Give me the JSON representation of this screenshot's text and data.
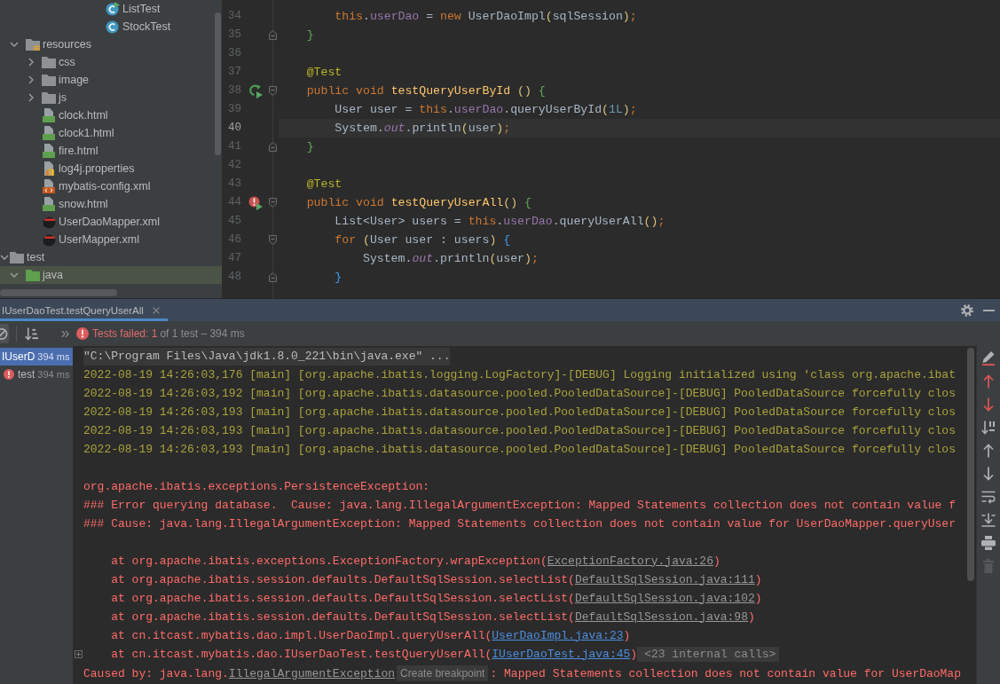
{
  "project_tree": {
    "items": [
      {
        "children": [
          {
            "children": [
              {
                "children": [
                  {
                    "children": [
                      {
                        "children": [
                          {
                            "children": [
                              {
                                "label": "ListTest",
                                "kind": "testclass",
                                "selected": false
                              },
                              {
                                "label": "StockTest",
                                "kind": "class",
                                "selected": false
                              }
                            ]
                          }
                        ]
                      }
                    ]
                  }
                ]
              }
            ]
          },
          {
            "label": "resources",
            "kind": "resfolder",
            "expanded": true,
            "selected": false,
            "children": [
              {
                "label": "css",
                "kind": "folder",
                "expanded": false,
                "selected": false
              },
              {
                "label": "image",
                "kind": "folder",
                "expanded": false,
                "selected": false
              },
              {
                "label": "js",
                "kind": "folder",
                "expanded": false,
                "selected": false
              },
              {
                "label": "clock.html",
                "kind": "html",
                "selected": false
              },
              {
                "label": "clock1.html",
                "kind": "html",
                "selected": false
              },
              {
                "label": "fire.html",
                "kind": "html",
                "selected": false
              },
              {
                "label": "log4j.properties",
                "kind": "props",
                "selected": false
              },
              {
                "label": "mybatis-config.xml",
                "kind": "xml",
                "selected": false
              },
              {
                "label": "snow.html",
                "kind": "html",
                "selected": false
              },
              {
                "label": "UserDaoMapper.xml",
                "kind": "mapper",
                "selected": false
              },
              {
                "label": "UserMapper.xml",
                "kind": "mapper",
                "selected": false
              }
            ]
          }
        ]
      },
      {
        "label": "test",
        "kind": "folder",
        "expanded": true,
        "selected": false,
        "children": [
          {
            "label": "java",
            "kind": "testroot",
            "expanded": true,
            "selected": true
          }
        ]
      }
    ]
  },
  "editor": {
    "lines": [
      {
        "number": "34",
        "current": false,
        "fold_start": false,
        "fold_end": false,
        "test_passed": false,
        "test_failed": false,
        "tokens": [
          {
            "text": "        this",
            "kind": "kw"
          },
          {
            "text": ".",
            "kind": "plain"
          },
          {
            "text": "userDao",
            "kind": "field"
          },
          {
            "text": " = ",
            "kind": "plain"
          },
          {
            "text": "new",
            "kind": "kw"
          },
          {
            "text": " UserDaoImpl",
            "kind": "plain"
          },
          {
            "text": "(",
            "kind": "b1"
          },
          {
            "text": "sqlSession",
            "kind": "plain"
          },
          {
            "text": ")",
            "kind": "b1"
          },
          {
            "text": ";",
            "kind": "kw"
          }
        ]
      },
      {
        "number": "35",
        "current": false,
        "fold_start": false,
        "fold_end": true,
        "test_passed": false,
        "test_failed": false,
        "tokens": [
          {
            "text": "    }",
            "kind": "b2"
          }
        ]
      },
      {
        "number": "36",
        "current": false,
        "fold_start": false,
        "fold_end": false,
        "test_passed": false,
        "test_failed": false
      },
      {
        "number": "37",
        "current": false,
        "fold_start": false,
        "fold_end": false,
        "test_passed": false,
        "test_failed": false,
        "tokens": [
          {
            "text": "    @Test",
            "kind": "annot"
          }
        ]
      },
      {
        "number": "38",
        "current": false,
        "fold_start": true,
        "fold_end": false,
        "test_passed": true,
        "test_failed": false,
        "tokens": [
          {
            "text": "    public void ",
            "kind": "kw"
          },
          {
            "text": "testQueryUserById ",
            "kind": "method"
          },
          {
            "text": "() ",
            "kind": "b1"
          },
          {
            "text": "{",
            "kind": "b2"
          }
        ]
      },
      {
        "number": "39",
        "current": false,
        "fold_start": false,
        "fold_end": false,
        "test_passed": false,
        "test_failed": false,
        "tokens": [
          {
            "text": "        User user = ",
            "kind": "plain"
          },
          {
            "text": "this",
            "kind": "kw"
          },
          {
            "text": ".",
            "kind": "plain"
          },
          {
            "text": "userDao",
            "kind": "field"
          },
          {
            "text": ".queryUserById",
            "kind": "plain"
          },
          {
            "text": "(",
            "kind": "b1"
          },
          {
            "text": "1L",
            "kind": "num"
          },
          {
            "text": ")",
            "kind": "b1"
          },
          {
            "text": ";",
            "kind": "kw"
          }
        ]
      },
      {
        "number": "40",
        "current": true,
        "fold_start": false,
        "fold_end": false,
        "test_passed": false,
        "test_failed": false,
        "tokens": [
          {
            "text": "        System.",
            "kind": "plain"
          },
          {
            "text": "out",
            "kind": "static"
          },
          {
            "text": ".println",
            "kind": "plain"
          },
          {
            "text": "(",
            "kind": "b1"
          },
          {
            "text": "user",
            "kind": "plain"
          },
          {
            "text": ")",
            "kind": "b1"
          },
          {
            "text": ";",
            "kind": "kw"
          }
        ]
      },
      {
        "number": "41",
        "current": false,
        "fold_start": false,
        "fold_end": true,
        "test_passed": false,
        "test_failed": false,
        "tokens": [
          {
            "text": "    }",
            "kind": "b2"
          }
        ]
      },
      {
        "number": "42",
        "current": false,
        "fold_start": false,
        "fold_end": false,
        "test_passed": false,
        "test_failed": false
      },
      {
        "number": "43",
        "current": false,
        "fold_start": false,
        "fold_end": false,
        "test_passed": false,
        "test_failed": false,
        "tokens": [
          {
            "text": "    @Test",
            "kind": "annot"
          }
        ]
      },
      {
        "number": "44",
        "current": false,
        "fold_start": true,
        "fold_end": false,
        "test_passed": false,
        "test_failed": true,
        "tokens": [
          {
            "text": "    public void ",
            "kind": "kw"
          },
          {
            "text": "testQueryUserAll",
            "kind": "method"
          },
          {
            "text": "() ",
            "kind": "b1"
          },
          {
            "text": "{",
            "kind": "b2"
          }
        ]
      },
      {
        "number": "45",
        "current": false,
        "fold_start": false,
        "fold_end": false,
        "test_passed": false,
        "test_failed": false,
        "tokens": [
          {
            "text": "        List<User> users = ",
            "kind": "plain"
          },
          {
            "text": "this",
            "kind": "kw"
          },
          {
            "text": ".",
            "kind": "plain"
          },
          {
            "text": "userDao",
            "kind": "field"
          },
          {
            "text": ".queryUserAll",
            "kind": "plain"
          },
          {
            "text": "()",
            "kind": "b1"
          },
          {
            "text": ";",
            "kind": "kw"
          }
        ]
      },
      {
        "number": "46",
        "current": false,
        "fold_start": true,
        "fold_end": false,
        "test_passed": false,
        "test_failed": false,
        "tokens": [
          {
            "text": "        for ",
            "kind": "kw"
          },
          {
            "text": "(",
            "kind": "b1"
          },
          {
            "text": "User user : users",
            "kind": "plain"
          },
          {
            "text": ") ",
            "kind": "b1"
          },
          {
            "text": "{",
            "kind": "b3"
          }
        ]
      },
      {
        "number": "47",
        "current": false,
        "fold_start": false,
        "fold_end": false,
        "test_passed": false,
        "test_failed": false,
        "tokens": [
          {
            "text": "            System.",
            "kind": "plain"
          },
          {
            "text": "out",
            "kind": "static"
          },
          {
            "text": ".println",
            "kind": "plain"
          },
          {
            "text": "(",
            "kind": "b1"
          },
          {
            "text": "user",
            "kind": "plain"
          },
          {
            "text": ")",
            "kind": "b1"
          },
          {
            "text": ";",
            "kind": "kw"
          }
        ]
      },
      {
        "number": "48",
        "current": false,
        "fold_start": false,
        "fold_end": true,
        "test_passed": false,
        "test_failed": false,
        "tokens": [
          {
            "text": "        }",
            "kind": "b3"
          }
        ]
      }
    ]
  },
  "run_panel": {
    "tab": {
      "label": "IUserDaoTest.testQueryUserAll",
      "selected": true
    },
    "status": {
      "failed": "Tests failed: 1",
      "detail": "of 1 test – 394 ms"
    },
    "test_tree": [
      {
        "label": "IUserD",
        "duration": "394 ms",
        "selected": true,
        "failed": false
      },
      {
        "label": "test",
        "duration": "394 ms",
        "selected": false,
        "failed": true
      }
    ],
    "console": {
      "lines": [
        {
          "kind": "command",
          "fold_toggle": false,
          "parts": [
            {
              "kind": "text",
              "text": "\"C:\\Program Files\\Java\\jdk1.8.0_221\\bin\\java.exe\" ..."
            }
          ]
        },
        {
          "kind": "log",
          "fold_toggle": false,
          "parts": [
            {
              "kind": "text",
              "text": "2022-08-19 14:26:03,176 [main] [org.apache.ibatis.logging.LogFactory]-[DEBUG] Logging initialized using 'class org.apache.ibat"
            }
          ]
        },
        {
          "kind": "log",
          "fold_toggle": false,
          "parts": [
            {
              "kind": "text",
              "text": "2022-08-19 14:26:03,192 [main] [org.apache.ibatis.datasource.pooled.PooledDataSource]-[DEBUG] PooledDataSource forcefully clos"
            }
          ]
        },
        {
          "kind": "log",
          "fold_toggle": false,
          "parts": [
            {
              "kind": "text",
              "text": "2022-08-19 14:26:03,193 [main] [org.apache.ibatis.datasource.pooled.PooledDataSource]-[DEBUG] PooledDataSource forcefully clos"
            }
          ]
        },
        {
          "kind": "log",
          "fold_toggle": false,
          "parts": [
            {
              "kind": "text",
              "text": "2022-08-19 14:26:03,193 [main] [org.apache.ibatis.datasource.pooled.PooledDataSource]-[DEBUG] PooledDataSource forcefully clos"
            }
          ]
        },
        {
          "kind": "log",
          "fold_toggle": false,
          "parts": [
            {
              "kind": "text",
              "text": "2022-08-19 14:26:03,193 [main] [org.apache.ibatis.datasource.pooled.PooledDataSource]-[DEBUG] PooledDataSource forcefully clos"
            }
          ]
        },
        {
          "kind": "blank",
          "fold_toggle": false
        },
        {
          "kind": "error",
          "fold_toggle": false,
          "parts": [
            {
              "kind": "text",
              "text": "org.apache.ibatis.exceptions.PersistenceException:"
            }
          ]
        },
        {
          "kind": "error",
          "fold_toggle": false,
          "parts": [
            {
              "kind": "text",
              "text": "### Error querying database.  Cause: java.lang.IllegalArgumentException: Mapped Statements collection does not contain value f"
            }
          ]
        },
        {
          "kind": "error",
          "fold_toggle": false,
          "parts": [
            {
              "kind": "text",
              "text": "### Cause: java.lang.IllegalArgumentException: Mapped Statements collection does not contain value for UserDaoMapper.queryUser"
            }
          ]
        },
        {
          "kind": "blank",
          "fold_toggle": false
        },
        {
          "kind": "error",
          "fold_toggle": false,
          "parts": [
            {
              "kind": "text",
              "text": "    at org.apache.ibatis.exceptions.ExceptionFactory.wrapException("
            },
            {
              "kind": "link",
              "text": "ExceptionFactory.java:26"
            },
            {
              "kind": "text",
              "text": ")"
            }
          ]
        },
        {
          "kind": "error",
          "fold_toggle": false,
          "parts": [
            {
              "kind": "text",
              "text": "    at org.apache.ibatis.session.defaults.DefaultSqlSession.selectList("
            },
            {
              "kind": "link",
              "text": "DefaultSqlSession.java:111"
            },
            {
              "kind": "text",
              "text": ")"
            }
          ]
        },
        {
          "kind": "error",
          "fold_toggle": false,
          "parts": [
            {
              "kind": "text",
              "text": "    at org.apache.ibatis.session.defaults.DefaultSqlSession.selectList("
            },
            {
              "kind": "link",
              "text": "DefaultSqlSession.java:102"
            },
            {
              "kind": "text",
              "text": ")"
            }
          ]
        },
        {
          "kind": "error",
          "fold_toggle": false,
          "parts": [
            {
              "kind": "text",
              "text": "    at org.apache.ibatis.session.defaults.DefaultSqlSession.selectList("
            },
            {
              "kind": "link",
              "text": "DefaultSqlSession.java:98"
            },
            {
              "kind": "text",
              "text": ")"
            }
          ]
        },
        {
          "kind": "error",
          "fold_toggle": false,
          "parts": [
            {
              "kind": "text",
              "text": "    at cn.itcast.mybatis.dao.impl.UserDaoImpl.queryUserAll("
            },
            {
              "kind": "srclink",
              "text": "UserDaoImpl.java:23"
            },
            {
              "kind": "text",
              "text": ")"
            }
          ]
        },
        {
          "kind": "error",
          "fold_toggle": true,
          "parts": [
            {
              "kind": "text",
              "text": "    at cn.itcast.mybatis.dao.IUserDaoTest.testQueryUserAll("
            },
            {
              "kind": "srclink",
              "text": "IUserDaoTest.java:45"
            },
            {
              "kind": "text",
              "text": ")"
            },
            {
              "kind": "folded",
              "text": "<23 internal calls>"
            }
          ]
        },
        {
          "kind": "error",
          "fold_toggle": false,
          "parts": [
            {
              "kind": "text",
              "text": "Caused by: java.lang."
            },
            {
              "kind": "link",
              "text": "IllegalArgumentException"
            },
            {
              "kind": "hint",
              "text": "Create breakpoint"
            },
            {
              "kind": "text",
              "text": ": Mapped Statements collection does not contain value for UserDaoMap"
            }
          ]
        }
      ]
    },
    "side_toolbar": [
      {
        "kind": "highlight",
        "disabled": false
      },
      {
        "kind": "prevfail",
        "disabled": false
      },
      {
        "kind": "nextfail",
        "disabled": false
      },
      {
        "kind": "sort",
        "disabled": false
      },
      {
        "kind": "up",
        "disabled": false
      },
      {
        "kind": "down",
        "disabled": false
      },
      {
        "kind": "wrap",
        "disabled": false
      },
      {
        "kind": "scrollend",
        "disabled": false
      },
      {
        "kind": "print",
        "disabled": false
      },
      {
        "kind": "clear",
        "disabled": true
      }
    ]
  }
}
